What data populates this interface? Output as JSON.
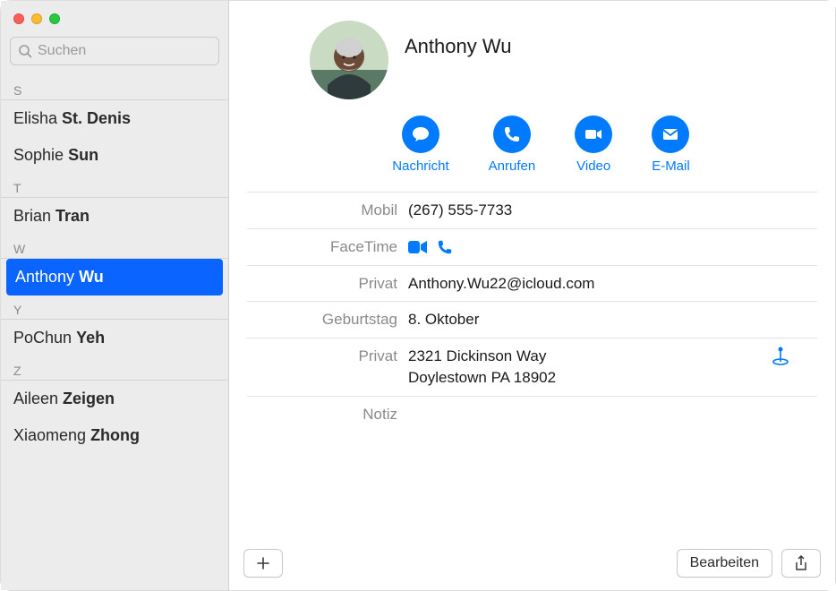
{
  "search": {
    "placeholder": "Suchen"
  },
  "sections": [
    {
      "letter": "S",
      "items": [
        {
          "first": "Elisha",
          "last": "St. Denis",
          "sel": false
        },
        {
          "first": "Sophie",
          "last": "Sun",
          "sel": false
        }
      ]
    },
    {
      "letter": "T",
      "items": [
        {
          "first": "Brian",
          "last": "Tran",
          "sel": false
        }
      ]
    },
    {
      "letter": "W",
      "items": [
        {
          "first": "Anthony",
          "last": "Wu",
          "sel": true
        }
      ]
    },
    {
      "letter": "Y",
      "items": [
        {
          "first": "PoChun",
          "last": "Yeh",
          "sel": false
        }
      ]
    },
    {
      "letter": "Z",
      "items": [
        {
          "first": "Aileen",
          "last": "Zeigen",
          "sel": false
        },
        {
          "first": "Xiaomeng",
          "last": "Zhong",
          "sel": false
        }
      ]
    }
  ],
  "contact": {
    "name": "Anthony Wu",
    "actions": {
      "message": "Nachricht",
      "call": "Anrufen",
      "video": "Video",
      "email": "E-Mail"
    },
    "fields": {
      "mobile_label": "Mobil",
      "mobile_value": "(267) 555-7733",
      "facetime_label": "FaceTime",
      "email_label": "Privat",
      "email_value": "Anthony.Wu22@icloud.com",
      "birthday_label": "Geburtstag",
      "birthday_value": "8. Oktober",
      "address_label": "Privat",
      "address_value": "2321 Dickinson Way\nDoylestown PA 18902",
      "note_label": "Notiz"
    }
  },
  "footer": {
    "edit": "Bearbeiten"
  }
}
